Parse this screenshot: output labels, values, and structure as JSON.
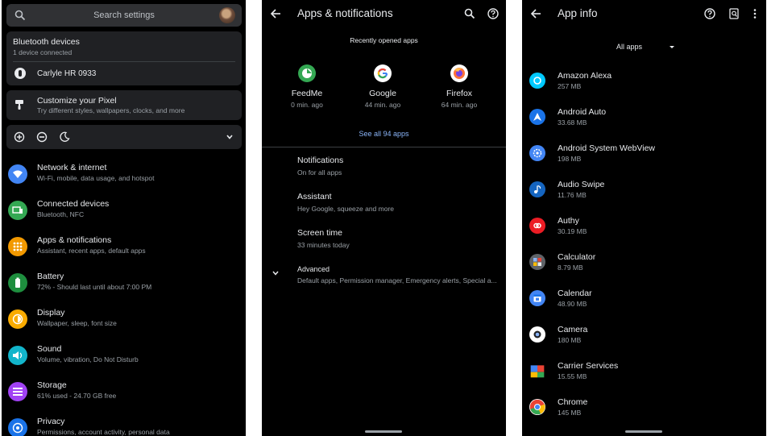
{
  "colors": {
    "background": "#000000",
    "card": "#202124",
    "text": "#e8eaed",
    "subtext": "#9aa0a6",
    "link": "#8ab4f8"
  },
  "settings": {
    "search_placeholder": "Search settings",
    "bluetooth": {
      "title": "Bluetooth devices",
      "subtitle": "1 device connected",
      "device": "Carlyle HR 0933"
    },
    "customize": {
      "title": "Customize your Pixel",
      "subtitle": "Try different styles, wallpapers, clocks, and more"
    },
    "quick_icons": [
      "data-saver-icon",
      "do-not-disturb-icon",
      "dark-theme-icon"
    ],
    "items": [
      {
        "title": "Network & internet",
        "subtitle": "Wi-Fi, mobile, data usage, and hotspot",
        "icon": "wifi-icon",
        "color": "#4285f4"
      },
      {
        "title": "Connected devices",
        "subtitle": "Bluetooth, NFC",
        "icon": "devices-icon",
        "color": "#34a853"
      },
      {
        "title": "Apps & notifications",
        "subtitle": "Assistant, recent apps, default apps",
        "icon": "apps-icon",
        "color": "#f29900"
      },
      {
        "title": "Battery",
        "subtitle": "72% - Should last until about 7:00 PM",
        "icon": "battery-icon",
        "color": "#1e8e3e"
      },
      {
        "title": "Display",
        "subtitle": "Wallpaper, sleep, font size",
        "icon": "brightness-icon",
        "color": "#f9ab00"
      },
      {
        "title": "Sound",
        "subtitle": "Volume, vibration, Do Not Disturb",
        "icon": "volume-icon",
        "color": "#12b5cb"
      },
      {
        "title": "Storage",
        "subtitle": "61% used - 24.70 GB free",
        "icon": "storage-icon",
        "color": "#a142f4"
      },
      {
        "title": "Privacy",
        "subtitle": "Permissions, account activity, personal data",
        "icon": "privacy-icon",
        "color": "#1a73e8"
      }
    ]
  },
  "apps_notifications": {
    "title": "Apps & notifications",
    "recent_label": "Recently opened apps",
    "recent_apps": [
      {
        "name": "FeedMe",
        "time": "0 min. ago"
      },
      {
        "name": "Google",
        "time": "44 min. ago"
      },
      {
        "name": "Firefox",
        "time": "64 min. ago"
      }
    ],
    "see_all": "See all 94 apps",
    "options": [
      {
        "title": "Notifications",
        "subtitle": "On for all apps"
      },
      {
        "title": "Assistant",
        "subtitle": "Hey Google, squeeze and more"
      },
      {
        "title": "Screen time",
        "subtitle": "33 minutes today"
      },
      {
        "title": "Advanced",
        "subtitle": "Default apps, Permission manager, Emergency alerts, Special a..."
      }
    ]
  },
  "app_info": {
    "title": "App info",
    "filter": "All apps",
    "apps": [
      {
        "name": "Amazon Alexa",
        "size": "257 MB",
        "color": "#00caff"
      },
      {
        "name": "Android Auto",
        "size": "33.68 MB",
        "color": "#1a73e8"
      },
      {
        "name": "Android System WebView",
        "size": "198 MB",
        "color": "#4285f4"
      },
      {
        "name": "Audio Swipe",
        "size": "11.76 MB",
        "color": "#1565c0"
      },
      {
        "name": "Authy",
        "size": "30.19 MB",
        "color": "#ec1c24"
      },
      {
        "name": "Calculator",
        "size": "8.79 MB",
        "color": "#5f6368"
      },
      {
        "name": "Calendar",
        "size": "48.90 MB",
        "color": "#4285f4"
      },
      {
        "name": "Camera",
        "size": "180 MB",
        "color": "#4285f4"
      },
      {
        "name": "Carrier Services",
        "size": "15.55 MB",
        "color": "#34a853"
      },
      {
        "name": "Chrome",
        "size": "145 MB",
        "color": "#ea4335"
      }
    ]
  }
}
